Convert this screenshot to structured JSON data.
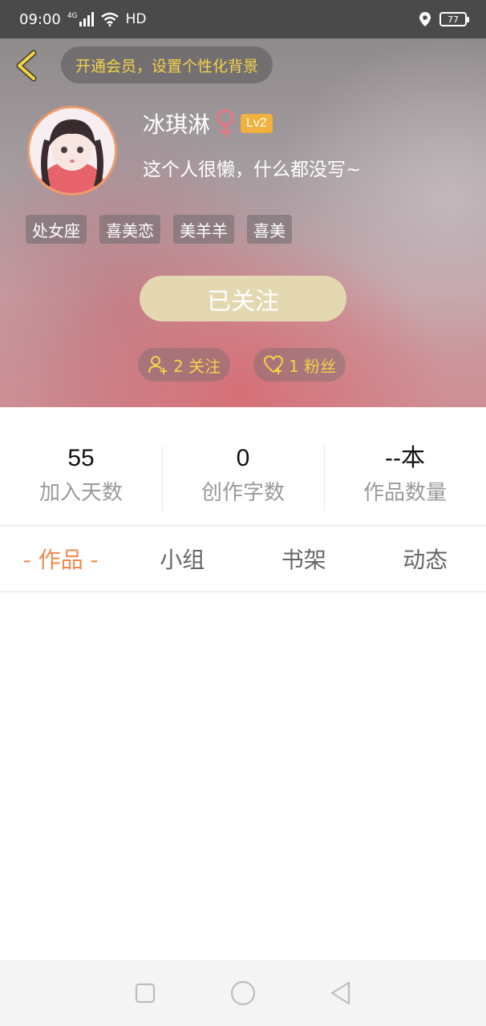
{
  "status_bar": {
    "time": "09:00",
    "network": "4G",
    "hd": "HD",
    "battery": "77"
  },
  "header": {
    "vip_text": "开通会员，设置个性化背景"
  },
  "profile": {
    "username": "冰琪淋",
    "level": "Lv2",
    "bio": "这个人很懒，什么都没写~",
    "tags": [
      "处女座",
      "喜美恋",
      "美羊羊",
      "喜美"
    ],
    "follow_button": "已关注",
    "following_count": "2 关注",
    "fans_count": "1 粉丝"
  },
  "stats": [
    {
      "value": "55",
      "label": "加入天数"
    },
    {
      "value": "0",
      "label": "创作字数"
    },
    {
      "value": "--本",
      "label": "作品数量"
    }
  ],
  "tabs": [
    {
      "label": "- 作品 -",
      "active": true
    },
    {
      "label": "小组",
      "active": false
    },
    {
      "label": "书架",
      "active": false
    },
    {
      "label": "动态",
      "active": false
    }
  ],
  "colors": {
    "accent": "#ef8a4f",
    "vip_text": "#f3d24a",
    "level_badge": "#f2b03c",
    "follow_button": "#e4d8b1",
    "female_icon": "#e07b86"
  }
}
